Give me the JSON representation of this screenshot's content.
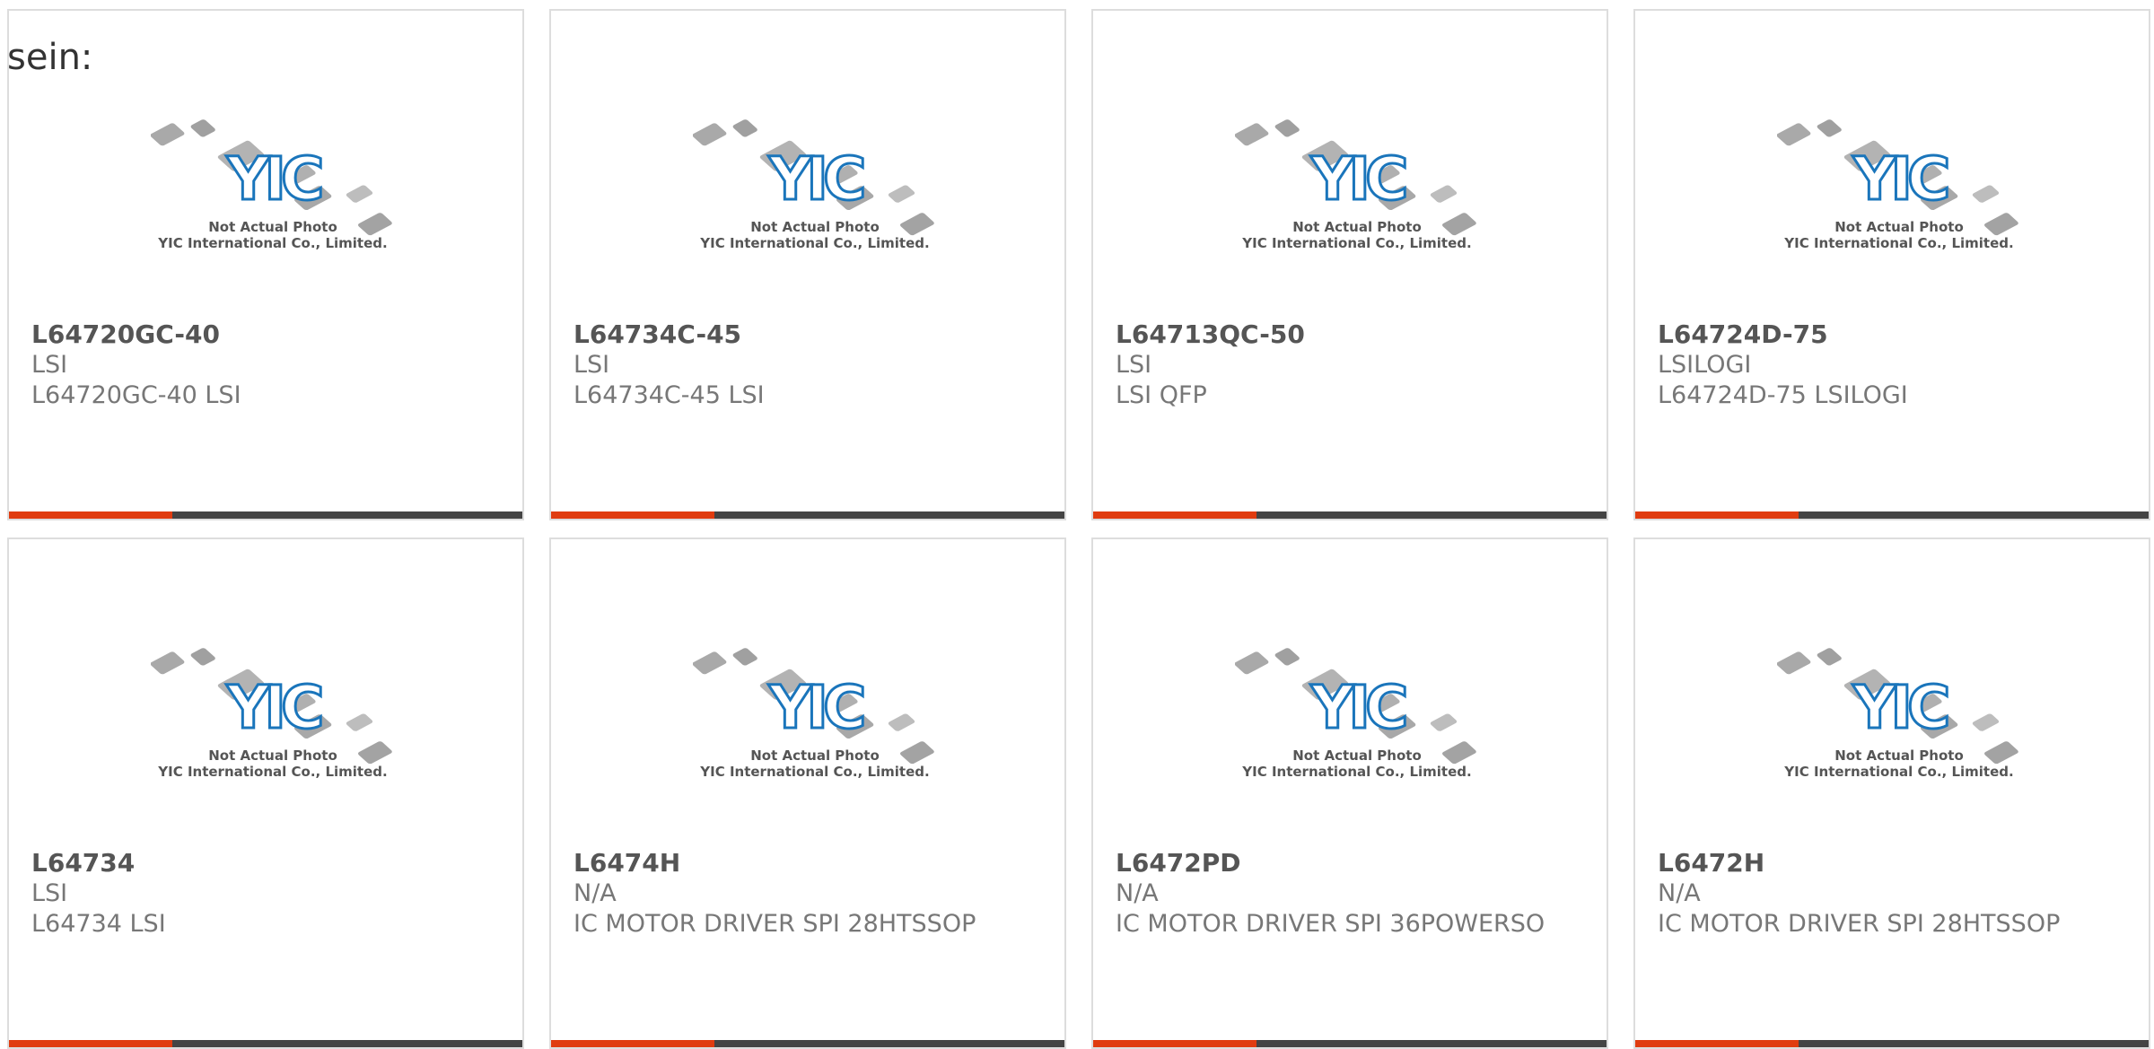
{
  "lead_text": "sein:",
  "placeholder_image": {
    "line1": "Not Actual Photo",
    "line2": "YIC International Co., Limited.",
    "logo": "YIC",
    "logo_color": "#1a75bb"
  },
  "accent_color": "#e03c10",
  "products": [
    {
      "name": "L64720GC-40",
      "brand": "LSI",
      "desc": "L64720GC-40 LSI"
    },
    {
      "name": "L64734C-45",
      "brand": "LSI",
      "desc": "L64734C-45 LSI"
    },
    {
      "name": "L64713QC-50",
      "brand": "LSI",
      "desc": "LSI QFP"
    },
    {
      "name": "L64724D-75",
      "brand": "LSILOGI",
      "desc": "L64724D-75 LSILOGI"
    },
    {
      "name": "L64734",
      "brand": "LSI",
      "desc": "L64734 LSI"
    },
    {
      "name": "L6474H",
      "brand": "N/A",
      "desc": "IC MOTOR DRIVER SPI 28HTSSOP"
    },
    {
      "name": "L6472PD",
      "brand": "N/A",
      "desc": "IC MOTOR DRIVER SPI 36POWERSO"
    },
    {
      "name": "L6472H",
      "brand": "N/A",
      "desc": "IC MOTOR DRIVER SPI 28HTSSOP"
    }
  ]
}
